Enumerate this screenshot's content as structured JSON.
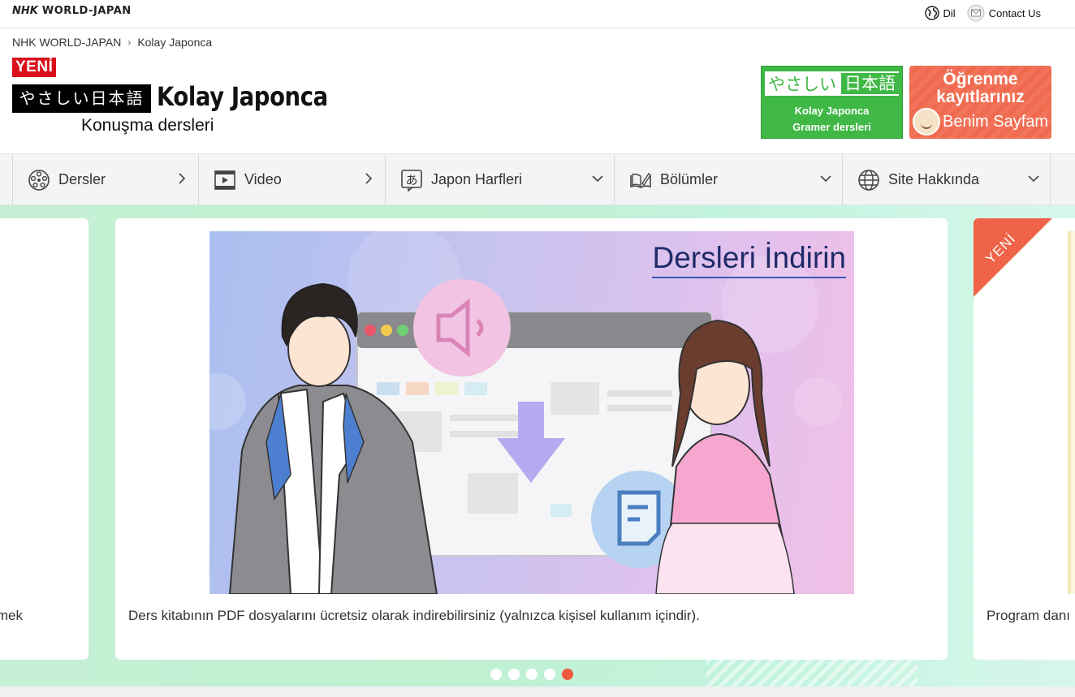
{
  "header": {
    "brand_nhk": "NHK",
    "brand_rest": "WORLD-JAPAN",
    "links": [
      {
        "label": "Dil",
        "icon": "globe-icon"
      },
      {
        "label": "Contact Us",
        "icon": "mail-icon"
      }
    ]
  },
  "breadcrumb": {
    "home": "NHK WORLD-JAPAN",
    "current": "Kolay Japonca"
  },
  "logo": {
    "new_badge": "YENİ",
    "jp_text": "やさしい日本語",
    "title": "Kolay Japonca",
    "subtitle": "Konuşma dersleri"
  },
  "banners": {
    "green": {
      "jp_a": "やさしい",
      "jp_b": "日本語",
      "line1": "Kolay Japonca",
      "line2": "Gramer dersleri"
    },
    "red": {
      "line1": "Öğrenme",
      "line2": "kayıtlarınız",
      "line3": "Benim Sayfam"
    }
  },
  "nav": {
    "items": [
      {
        "label": "Dersler",
        "icon": "lessons-icon",
        "chevron": "chevron-right-icon"
      },
      {
        "label": "Video",
        "icon": "video-icon",
        "chevron": "chevron-right-icon"
      },
      {
        "label": "Japon Harfleri",
        "icon": "japanese-letters-icon",
        "chevron": "chevron-down-icon"
      },
      {
        "label": "Bölümler",
        "icon": "book-icon",
        "chevron": "chevron-down-icon"
      },
      {
        "label": "Site Hakkında",
        "icon": "globe-icon",
        "chevron": "chevron-down-icon"
      }
    ]
  },
  "carousel": {
    "left_caption": "mek",
    "main_title": "Dersleri İndirin",
    "main_caption": "Ders kitabının PDF dosyalarını ücretsiz olarak indirebilirsiniz (yalnızca kişisel kullanım içindir).",
    "right_ribbon": "YENİ",
    "right_caption": "Program danı",
    "dot_count": 5,
    "active_dot": 5
  },
  "colors": {
    "accent_red": "#d90f1a",
    "banner_green": "#3fb845",
    "banner_orange": "#f06a4f",
    "active_dot": "#ee5b3f"
  }
}
